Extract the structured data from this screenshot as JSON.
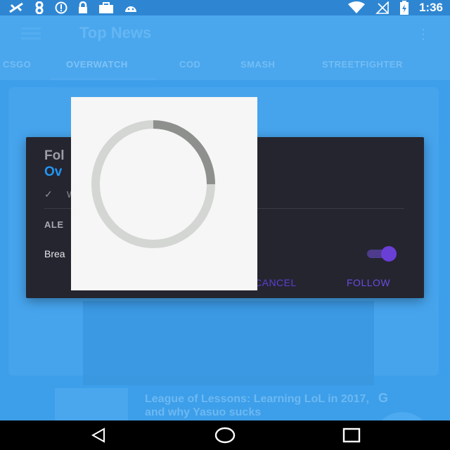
{
  "status_bar": {
    "time": "1:36",
    "left_icons": [
      "satellite-icon",
      "app-8-icon",
      "info-icon",
      "lock-icon",
      "briefcase-icon",
      "android-icon"
    ],
    "right_icons": [
      "wifi-icon",
      "no-signal-icon",
      "battery-charging-icon"
    ]
  },
  "app_bar": {
    "title": "Top News"
  },
  "tabs": [
    {
      "label": "CSGO"
    },
    {
      "label": "OVERWATCH"
    },
    {
      "label": "COD"
    },
    {
      "label": "SMASH"
    },
    {
      "label": "STREETFIGHTER"
    }
  ],
  "feed": {
    "article_title": "League of Lessons: Learning LoL in 2017, and why Yasuo sucks",
    "source_badge": "G"
  },
  "dialog": {
    "title": "Fol",
    "subtitle": "Ov",
    "check_label": "W",
    "section_label": "ALE",
    "row_label": "Brea",
    "toggle_on": true,
    "cancel_label": "CANCEL",
    "follow_label": "FOLLOW"
  },
  "loader": {
    "progress": 0.25
  },
  "colors": {
    "primary": "#3d9ee9",
    "dialog_bg": "#252530",
    "accent": "#6a4be0",
    "link_blue": "#2196f3"
  }
}
